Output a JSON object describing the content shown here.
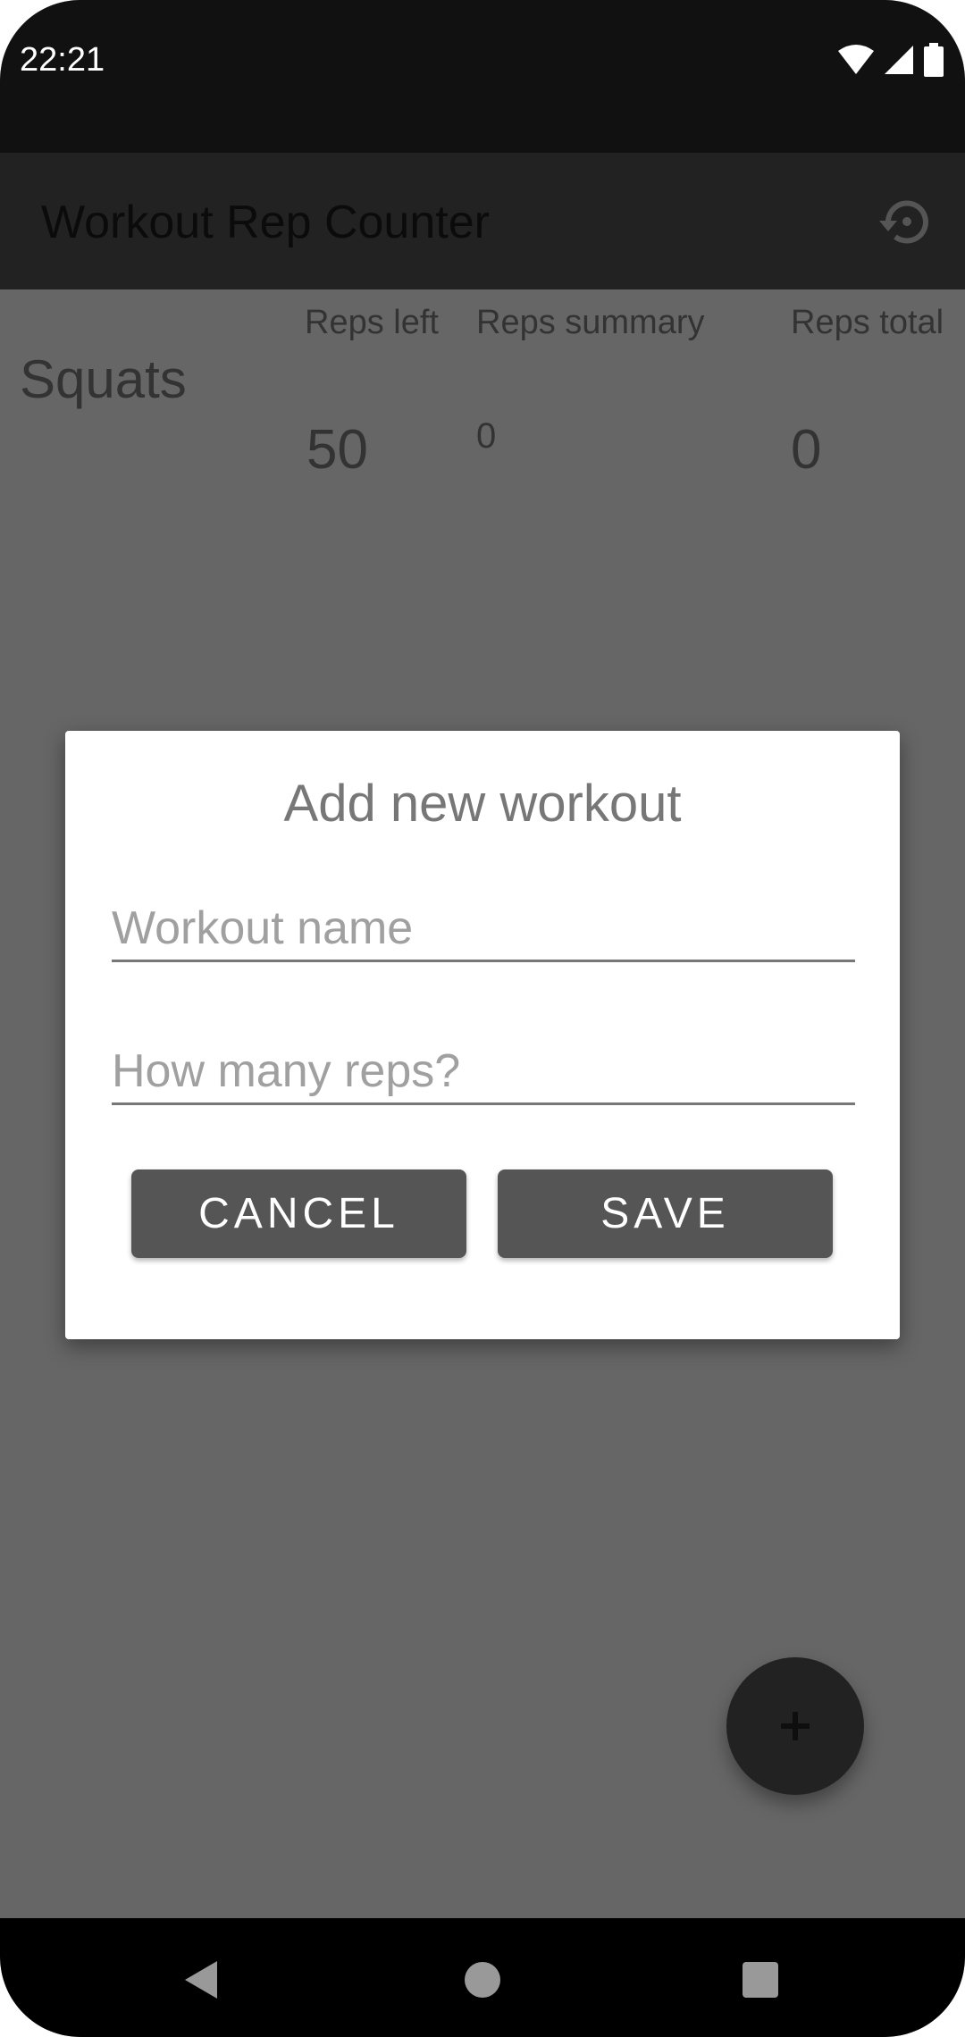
{
  "status_bar": {
    "time": "22:21",
    "icons": [
      "wifi-icon",
      "cellular-signal-icon",
      "battery-icon"
    ]
  },
  "toolbar": {
    "title": "Workout Rep Counter",
    "history_icon": "restore-icon"
  },
  "list": {
    "columns": [
      "Reps left",
      "Reps summary",
      "Reps total"
    ],
    "rows": [
      {
        "name": "Squats",
        "reps_left": "50",
        "reps_summary": "0",
        "reps_total": "0"
      }
    ]
  },
  "dialog": {
    "title": "Add new workout",
    "name_field": {
      "value": "",
      "placeholder": "Workout name"
    },
    "reps_field": {
      "value": "",
      "placeholder": "How many reps?"
    },
    "cancel_label": "CANCEL",
    "save_label": "SAVE"
  },
  "fab": {
    "icon": "plus-icon",
    "label": "+"
  },
  "nav": {
    "back": "back-icon",
    "home": "home-icon",
    "recents": "recents-icon"
  },
  "colors": {
    "scrim": "#666666",
    "toolbar": "#222222",
    "button": "#555555",
    "dialog": "#ffffff"
  }
}
